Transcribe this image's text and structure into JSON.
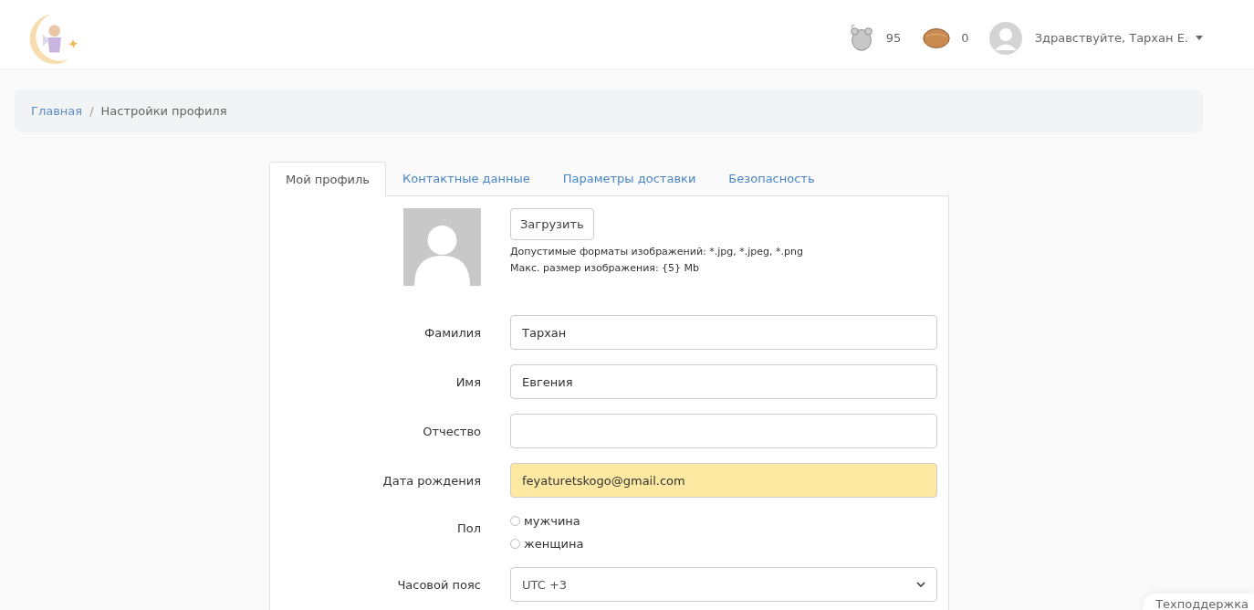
{
  "header": {
    "counters": [
      {
        "kind": "mouse",
        "value": "95"
      },
      {
        "kind": "nut",
        "value": "0"
      }
    ],
    "greeting": "Здравствуйте, Тархан Е."
  },
  "breadcrumb_separator": "/",
  "breadcrumb": [
    {
      "label": "Главная",
      "selected": false
    },
    {
      "label": "Настройки профиля",
      "selected": true
    }
  ],
  "tabs": [
    {
      "label": "Мой профиль",
      "selected": true
    },
    {
      "label": "Контактные данные",
      "selected": false
    },
    {
      "label": "Параметры доставки",
      "selected": false
    },
    {
      "label": "Безопасность",
      "selected": false
    }
  ],
  "avatar": {
    "upload_button": "Загрузить",
    "hints": [
      "Допустимые форматы изображений: *.jpg, *.jpeg, *.png",
      "Макс. размер изображения: {5} Mb"
    ]
  },
  "fields": [
    {
      "label": "Фамилия",
      "value": "Тархан",
      "autofilled": false
    },
    {
      "label": "Имя",
      "value": "Евгения",
      "autofilled": false
    },
    {
      "label": "Отчество",
      "autofilled": false
    },
    {
      "label": "Дата рождения",
      "value": "feyaturetskogo@gmail.com",
      "autofilled": true
    }
  ],
  "gender": {
    "label": "Пол",
    "options": [
      {
        "label": "мужчина",
        "selected": false
      },
      {
        "label": "женщина",
        "selected": false
      }
    ]
  },
  "timezone": {
    "label": "Часовой пояс",
    "value": "UTC +3"
  },
  "support_button": "Техподдержка"
}
